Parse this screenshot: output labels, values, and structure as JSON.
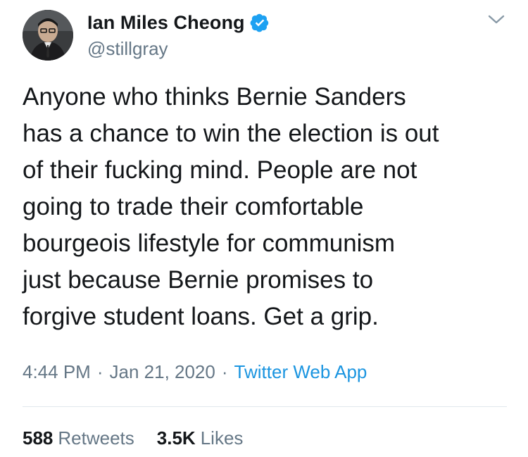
{
  "tweet": {
    "author": {
      "display_name": "Ian Miles Cheong",
      "handle": "@stillgray",
      "verified": true,
      "avatar_icon": "profile-photo"
    },
    "menu_icon": "chevron-down-icon",
    "text": "Anyone who thinks Bernie Sanders\nhas a chance to win the election is out\nof their fucking mind. People are not\ngoing to trade their comfortable\nbourgeois lifestyle for communism\njust because Bernie promises to\nforgive student loans. Get a grip.",
    "time": "4:44 PM",
    "separator": "·",
    "date": "Jan 21, 2020",
    "source": "Twitter Web App",
    "stats": {
      "retweets_count": "588",
      "retweets_label": "Retweets",
      "likes_count": "3.5K",
      "likes_label": "Likes"
    }
  },
  "colors": {
    "text_primary": "#14171a",
    "text_secondary": "#657786",
    "link": "#1b95e0",
    "verified": "#1da1f2",
    "divider": "#e1e8ed"
  }
}
